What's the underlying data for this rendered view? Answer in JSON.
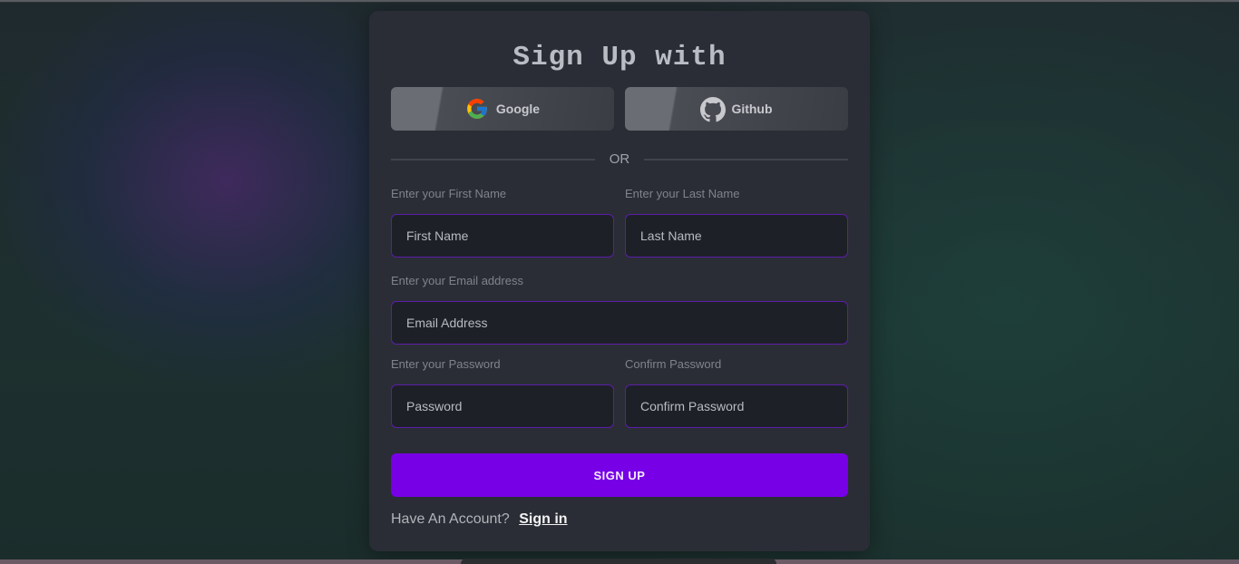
{
  "form": {
    "title": "Sign Up with",
    "social": {
      "google_label": "Google",
      "github_label": "Github"
    },
    "divider_text": "OR",
    "first_name": {
      "label": "Enter your First Name",
      "placeholder": "First Name",
      "value": ""
    },
    "last_name": {
      "label": "Enter your Last Name",
      "placeholder": "Last Name",
      "value": ""
    },
    "email": {
      "label": "Enter your Email address",
      "placeholder": "Email Address",
      "value": ""
    },
    "password": {
      "label": "Enter your Password",
      "placeholder": "Password",
      "value": ""
    },
    "confirm_password": {
      "label": "Confirm Password",
      "placeholder": "Confirm Password",
      "value": ""
    },
    "submit_label": "SIGN UP",
    "account_prompt": "Have An Account?",
    "signin_label": "Sign in"
  },
  "colors": {
    "accent": "#7700e6",
    "field_border": "#5b1ea8",
    "card_bg": "#2a2d35"
  },
  "icons": {
    "google": "google-icon",
    "github": "github-icon"
  }
}
